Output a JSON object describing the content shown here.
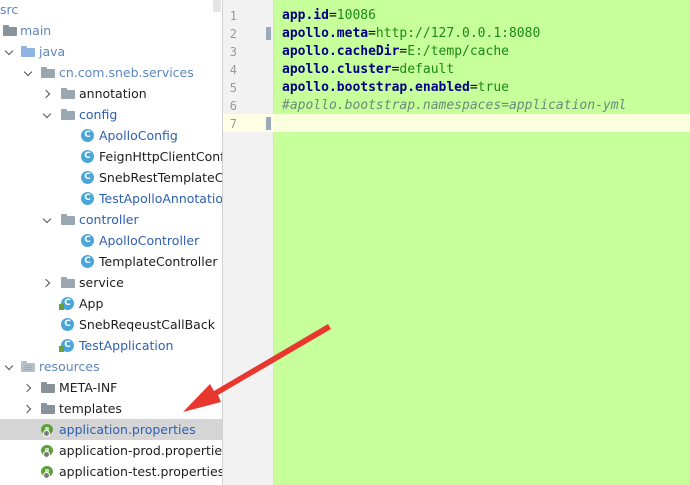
{
  "project_tree": {
    "rows": [
      {
        "label": "src",
        "style": "muted"
      },
      {
        "label": "main",
        "style": "muted"
      },
      {
        "label": "java",
        "style": "muted"
      },
      {
        "label": "cn.com.sneb.services",
        "style": "muted"
      },
      {
        "label": "annotation",
        "style": "dark"
      },
      {
        "label": "config",
        "style": "blue"
      },
      {
        "label": "ApolloConfig",
        "style": "blue"
      },
      {
        "label": "FeignHttpClientConfig",
        "style": "dark"
      },
      {
        "label": "SnebRestTemplateConfig",
        "style": "dark"
      },
      {
        "label": "TestApolloAnnotation",
        "style": "blue"
      },
      {
        "label": "controller",
        "style": "blue"
      },
      {
        "label": "ApolloController",
        "style": "blue"
      },
      {
        "label": "TemplateController",
        "style": "dark"
      },
      {
        "label": "service",
        "style": "dark"
      },
      {
        "label": "App",
        "style": "dark"
      },
      {
        "label": "SnebReqeustCallBack",
        "style": "dark"
      },
      {
        "label": "TestApplication",
        "style": "blue"
      },
      {
        "label": "resources",
        "style": "muted"
      },
      {
        "label": "META-INF",
        "style": "dark"
      },
      {
        "label": "templates",
        "style": "dark"
      },
      {
        "label": "application.properties",
        "style": "blue"
      },
      {
        "label": "application-prod.properties",
        "style": "dark"
      },
      {
        "label": "application-test.properties",
        "style": "dark"
      }
    ],
    "class_icon_letter": "C",
    "selected": "application.properties"
  },
  "editor": {
    "line_numbers": [
      "1",
      "2",
      "3",
      "4",
      "5",
      "6",
      "7"
    ],
    "lines": [
      {
        "key": "app.id",
        "sep": "=",
        "value": "10086"
      },
      {
        "key": "apollo.meta",
        "sep": "=",
        "value": "http://127.0.0.1:8080"
      },
      {
        "key": "apollo.cacheDir",
        "sep": "=",
        "value": "E:/temp/cache"
      },
      {
        "key": "apollo.cluster",
        "sep": "=",
        "value": "default"
      },
      {
        "key": "apollo.bootstrap.enabled",
        "sep": "=",
        "value": "true"
      },
      {
        "comment": "#apollo.bootstrap.namespaces=application-yml"
      },
      {
        "comment": ""
      }
    ],
    "background": "#c7ff9a"
  },
  "annotation": {
    "arrow_color": "#e8372e"
  }
}
